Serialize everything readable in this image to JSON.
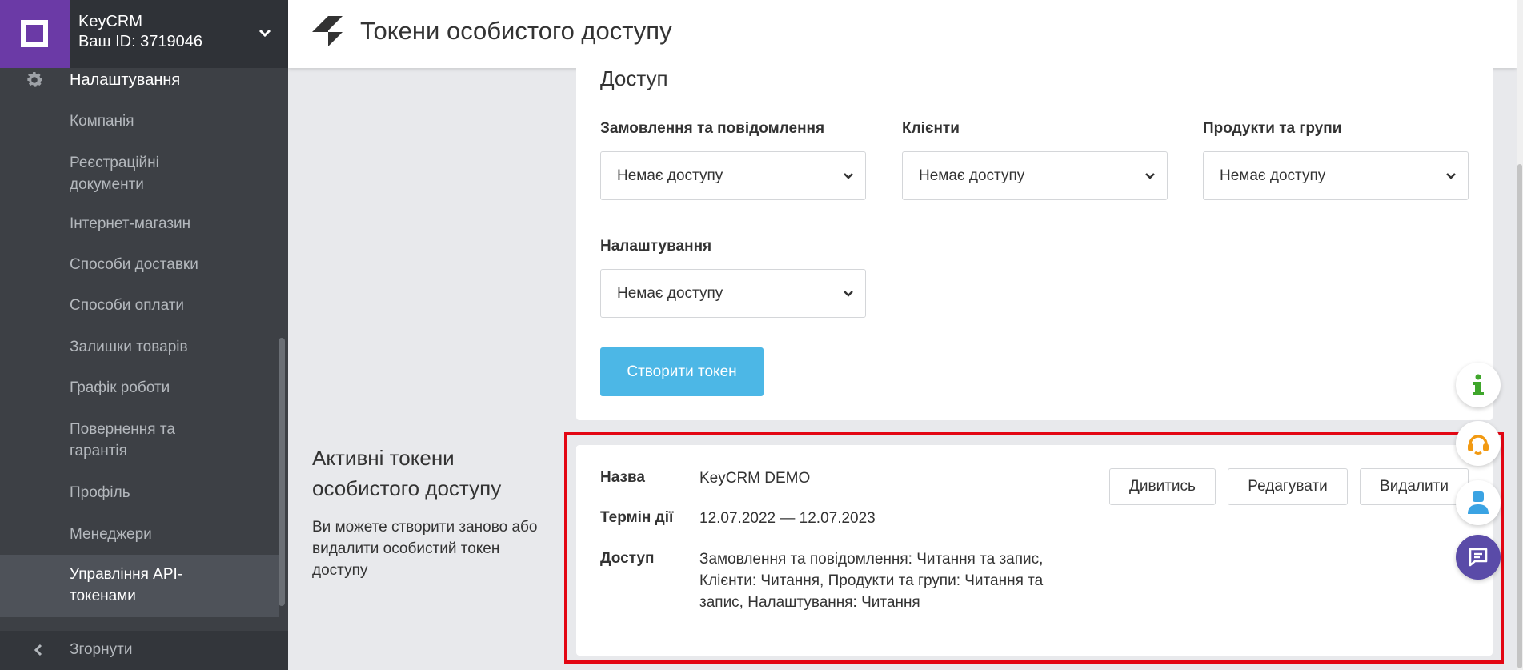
{
  "sidebar": {
    "brand": "KeyCRM",
    "user_id": "Ваш ID: 3719046",
    "section": "Налаштування",
    "items": [
      {
        "label": "Компанія"
      },
      {
        "label": "Реєстраційні документи"
      },
      {
        "label": "Інтернет-магазин"
      },
      {
        "label": "Способи доставки"
      },
      {
        "label": "Способи оплати"
      },
      {
        "label": "Залишки товарів"
      },
      {
        "label": "Графік роботи"
      },
      {
        "label": "Повернення та гарантія"
      },
      {
        "label": "Профіль"
      },
      {
        "label": "Менеджери"
      },
      {
        "label": "Управління API-токенами",
        "active": true
      }
    ],
    "collapse": "Згорнути"
  },
  "header": {
    "title": "Токени особистого доступу"
  },
  "access": {
    "heading": "Доступ",
    "fields": [
      {
        "label": "Замовлення та повідомлення",
        "value": "Немає доступу"
      },
      {
        "label": "Клієнти",
        "value": "Немає доступу"
      },
      {
        "label": "Продукти та групи",
        "value": "Немає доступу"
      },
      {
        "label": "Налаштування",
        "value": "Немає доступу"
      }
    ],
    "create_button": "Створити токен"
  },
  "active_tokens": {
    "title": "Активні токени особистого доступу",
    "description": "Ви можете створити заново або видалити особистий токен доступу",
    "token": {
      "name_label": "Назва",
      "name": "KeyCRM DEMO",
      "term_label": "Термін дії",
      "term": "12.07.2022 — 12.07.2023",
      "access_label": "Доступ",
      "access_lines": [
        "Замовлення та повідомлення: Читання та запис,",
        "Клієнти: Читання, Продукти та групи: Читання та",
        "запис, Налаштування: Читання"
      ],
      "view_button": "Дивитись",
      "edit_button": "Редагувати",
      "delete_button": "Видалити"
    }
  },
  "colors": {
    "brand": "#6b3aa6",
    "primary_button": "#4cb7e6",
    "highlight": "#e30613"
  }
}
